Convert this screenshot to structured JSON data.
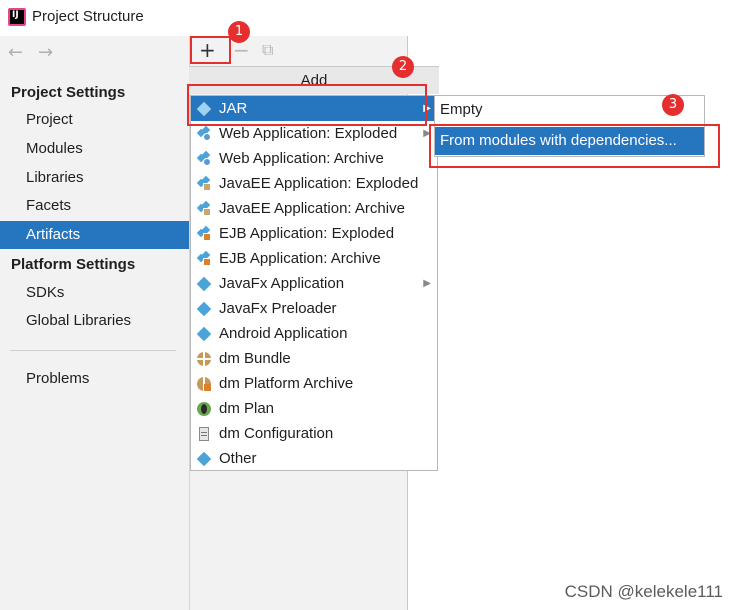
{
  "window": {
    "title": "Project Structure"
  },
  "nav": {
    "back_icon": "arrow-left-icon",
    "forward_icon": "arrow-right-icon"
  },
  "sidebar": {
    "project_settings_header": "Project Settings",
    "project_items": [
      "Project",
      "Modules",
      "Libraries",
      "Facets",
      "Artifacts"
    ],
    "selected": "Artifacts",
    "platform_settings_header": "Platform Settings",
    "platform_items": [
      "SDKs",
      "Global Libraries"
    ],
    "problems": "Problems"
  },
  "toolbar": {
    "add": "+",
    "remove": "−",
    "copy": "⧉"
  },
  "add_menu": {
    "header": "Add",
    "items": [
      "JAR",
      "Web Application: Exploded",
      "Web Application: Archive",
      "JavaEE Application: Exploded",
      "JavaEE Application: Archive",
      "EJB Application: Exploded",
      "EJB Application: Archive",
      "JavaFx Application",
      "JavaFx Preloader",
      "Android Application",
      "dm Bundle",
      "dm Platform Archive",
      "dm Plan",
      "dm Configuration",
      "Other"
    ]
  },
  "jar_submenu": {
    "items": [
      "Empty",
      "From modules with dependencies..."
    ]
  },
  "annotations": {
    "step1": "1",
    "step2": "2",
    "step3": "3"
  },
  "watermark": "CSDN @kelekele111",
  "colors": {
    "selection": "#2675bf",
    "annotation": "#e52f2f"
  }
}
